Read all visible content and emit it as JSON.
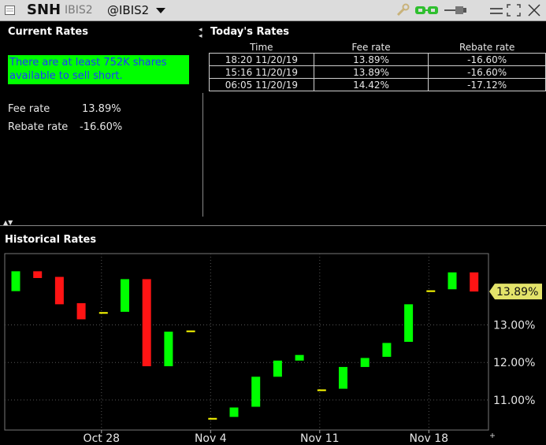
{
  "titlebar": {
    "symbol": "SNH",
    "exchange": "IBIS2",
    "route": "@IBIS2"
  },
  "current_rates": {
    "title": "Current Rates",
    "availability_message": "There are at least 752K shares available to sell short.",
    "fee_label": "Fee rate",
    "fee_value": "13.89%",
    "rebate_label": "Rebate rate",
    "rebate_value": "-16.60%"
  },
  "todays_rates": {
    "title": "Today's Rates",
    "columns": [
      "Time",
      "Fee rate",
      "Rebate rate"
    ],
    "rows": [
      {
        "time": "18:20  11/20/19",
        "fee": "13.89%",
        "rebate": "-16.60%"
      },
      {
        "time": "15:16  11/20/19",
        "fee": "13.89%",
        "rebate": "-16.60%"
      },
      {
        "time": "06:05  11/20/19",
        "fee": "14.42%",
        "rebate": "-17.12%"
      }
    ]
  },
  "historical": {
    "title": "Historical Rates",
    "current_label": "13.89%"
  },
  "colors": {
    "up": "#00ff00",
    "down": "#ff1414",
    "flat": "#ffff00",
    "price_tag": "#e3e36a"
  },
  "chart_data": {
    "type": "candlestick",
    "ylim": [
      10.2,
      14.9
    ],
    "y_ticks": [
      11.0,
      12.0,
      13.0
    ],
    "y_tick_labels": [
      "11.00%",
      "12.00%",
      "13.00%"
    ],
    "x_ticks": [
      {
        "label": "Oct 28",
        "index": 4
      },
      {
        "label": "Nov 4",
        "index": 9
      },
      {
        "label": "Nov 11",
        "index": 14
      },
      {
        "label": "Nov 18",
        "index": 19
      }
    ],
    "current_value": 13.89,
    "candles": [
      {
        "open": 13.9,
        "close": 14.43,
        "dir": "up"
      },
      {
        "open": 14.43,
        "close": 14.25,
        "dir": "down"
      },
      {
        "open": 14.28,
        "close": 13.55,
        "dir": "down"
      },
      {
        "open": 13.58,
        "close": 13.15,
        "dir": "down"
      },
      {
        "open": 13.32,
        "close": 13.32,
        "dir": "flat"
      },
      {
        "open": 13.35,
        "close": 14.22,
        "dir": "up"
      },
      {
        "open": 14.22,
        "close": 11.9,
        "dir": "down"
      },
      {
        "open": 11.9,
        "close": 12.82,
        "dir": "up"
      },
      {
        "open": 12.83,
        "close": 12.83,
        "dir": "flat"
      },
      {
        "open": 10.5,
        "close": 10.5,
        "dir": "flat"
      },
      {
        "open": 10.55,
        "close": 10.8,
        "dir": "up"
      },
      {
        "open": 10.82,
        "close": 11.62,
        "dir": "up"
      },
      {
        "open": 11.62,
        "close": 12.05,
        "dir": "up"
      },
      {
        "open": 12.05,
        "close": 12.2,
        "dir": "up"
      },
      {
        "open": 11.26,
        "close": 11.26,
        "dir": "flat"
      },
      {
        "open": 11.3,
        "close": 11.88,
        "dir": "up"
      },
      {
        "open": 11.88,
        "close": 12.12,
        "dir": "up"
      },
      {
        "open": 12.15,
        "close": 12.52,
        "dir": "up"
      },
      {
        "open": 12.55,
        "close": 13.55,
        "dir": "up"
      },
      {
        "open": 13.9,
        "close": 13.9,
        "dir": "flat"
      },
      {
        "open": 13.95,
        "close": 14.4,
        "dir": "up"
      },
      {
        "open": 14.4,
        "close": 13.89,
        "dir": "down"
      }
    ]
  }
}
